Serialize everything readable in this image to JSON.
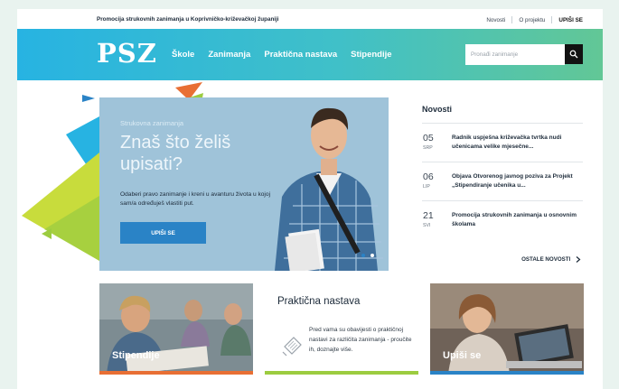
{
  "topbar": {
    "tagline": "Promocija strukovnih zanimanja u Koprivničko-križevačkoj županiji",
    "links": [
      "Novosti",
      "O projektu",
      "UPIŠI SE"
    ]
  },
  "nav": {
    "logo": "PSZ",
    "menu": [
      "Škole",
      "Zanimanja",
      "Praktična nastava",
      "Stipendije"
    ],
    "search_placeholder": "Pronađi zanimanje"
  },
  "hero": {
    "kicker": "Strukovna zanimanja",
    "headline": "Znaš što želiš upisati?",
    "description": "Odaberi pravo zanimanje i kreni u avanturu života u kojoj sam/a određuješ vlastiti put.",
    "cta": "UPIŠI SE",
    "active_slide": 1,
    "slide_count": 2
  },
  "news": {
    "title": "Novosti",
    "items": [
      {
        "day": "05",
        "month": "SRP",
        "title": "Radnik uspješna križevačka tvrtka nudi učenicama velike mjesečne..."
      },
      {
        "day": "06",
        "month": "LIP",
        "title": "Objava Otvorenog javnog poziva za Projekt „Stipendiranje učenika u..."
      },
      {
        "day": "21",
        "month": "SVI",
        "title": "Promocija strukovnih zanimanja u osnovnim školama"
      }
    ],
    "more": "OSTALE NOVOSTI"
  },
  "cards": {
    "stipendije": "Stipendije",
    "prakticna_title": "Praktična nastava",
    "prakticna_text": "Pred vama su obavijesti o praktičnoj nastavi za različita zanimanja - proučite ih, doznajte više.",
    "upisi": "Upiši se"
  },
  "colors": {
    "nav_from": "#27b3e2",
    "nav_to": "#62c796",
    "cta": "#2a83c6",
    "orange": "#e86f34",
    "green": "#9ccc40"
  },
  "icons": [
    "search-icon",
    "chevron-right-icon",
    "document-icon"
  ]
}
